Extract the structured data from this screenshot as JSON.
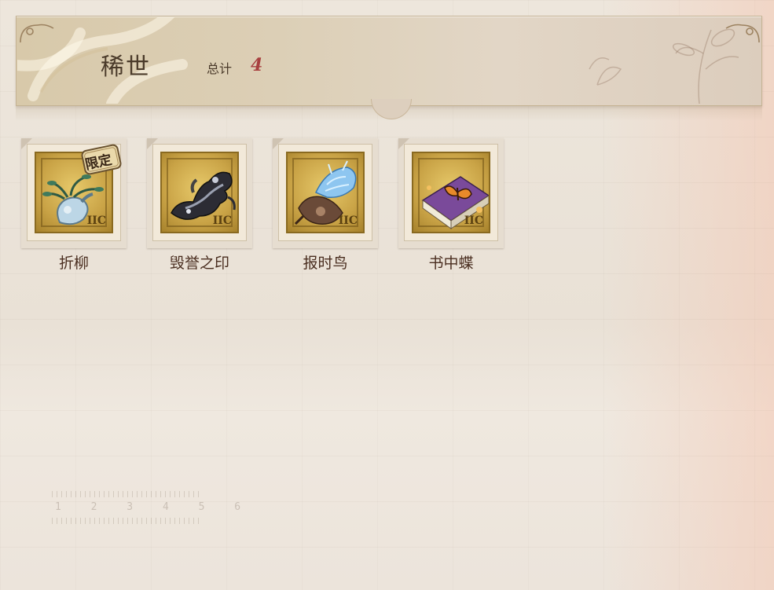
{
  "header": {
    "title": "稀世",
    "total_label": "总计",
    "total_value": "4"
  },
  "items": [
    {
      "name": "折柳",
      "stamp_value": "IIC",
      "badge": "限定",
      "icon": "vase-willow-icon"
    },
    {
      "name": "毁誉之印",
      "stamp_value": "IIC",
      "icon": "dark-seal-icon"
    },
    {
      "name": "报时鸟",
      "stamp_value": "IIC",
      "icon": "clockbird-icon"
    },
    {
      "name": "书中蝶",
      "stamp_value": "IIC",
      "icon": "book-butterfly-icon"
    }
  ],
  "decoration": {
    "ruler_digits": "1 2 3 4 5 6"
  }
}
